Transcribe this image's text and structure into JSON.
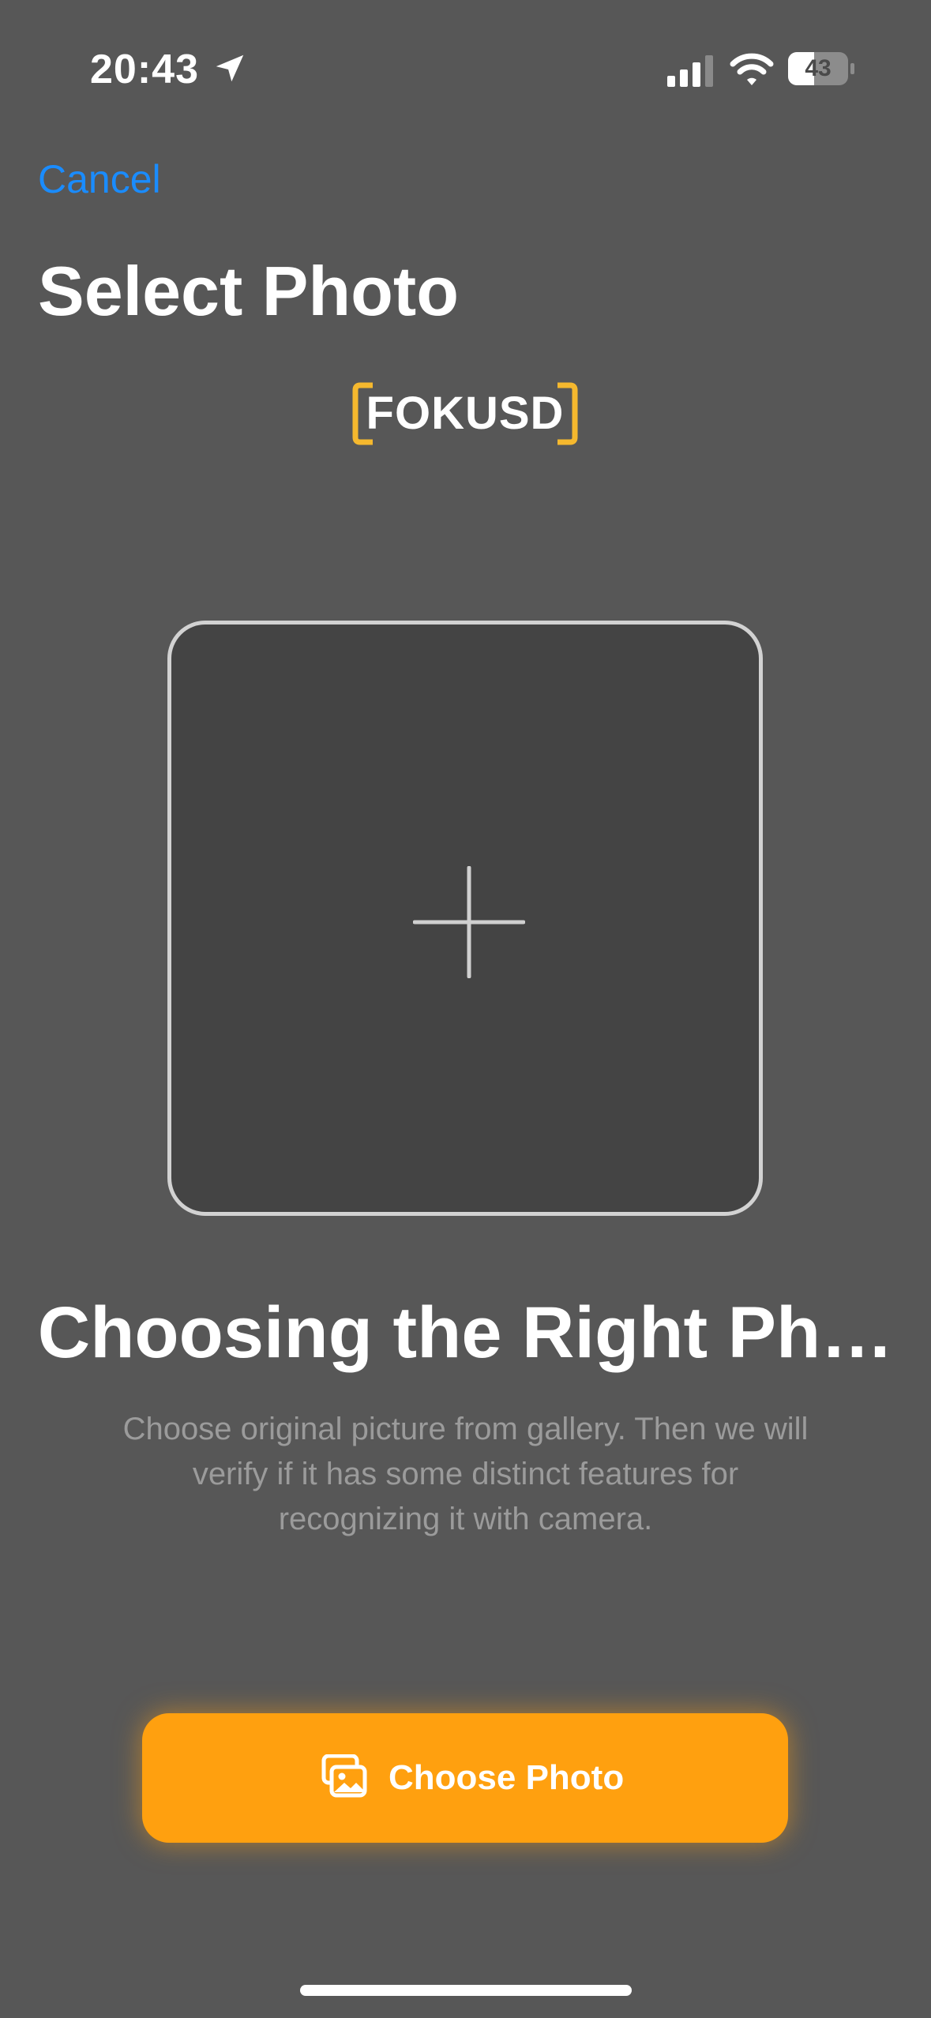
{
  "status_bar": {
    "time": "20:43",
    "battery_level": "43",
    "icons": [
      "location-arrow-icon",
      "cellular-signal-icon",
      "wifi-icon",
      "battery-icon"
    ]
  },
  "nav": {
    "cancel_label": "Cancel",
    "title": "Select Photo"
  },
  "logo": {
    "text": "FOKUSD",
    "accent_color": "#f5b82e"
  },
  "photo_picker": {
    "icon": "plus-icon"
  },
  "info": {
    "heading": "Choosing the Right Ph…",
    "description": "Choose original picture from gallery. Then we will verify if it has some distinct features for recognizing it with camera."
  },
  "primary_button": {
    "label": "Choose Photo",
    "icon": "photos-icon",
    "color": "#ffa00f"
  },
  "colors": {
    "background": "#575757",
    "link": "#1a8cff",
    "photo_box": "#444444"
  }
}
